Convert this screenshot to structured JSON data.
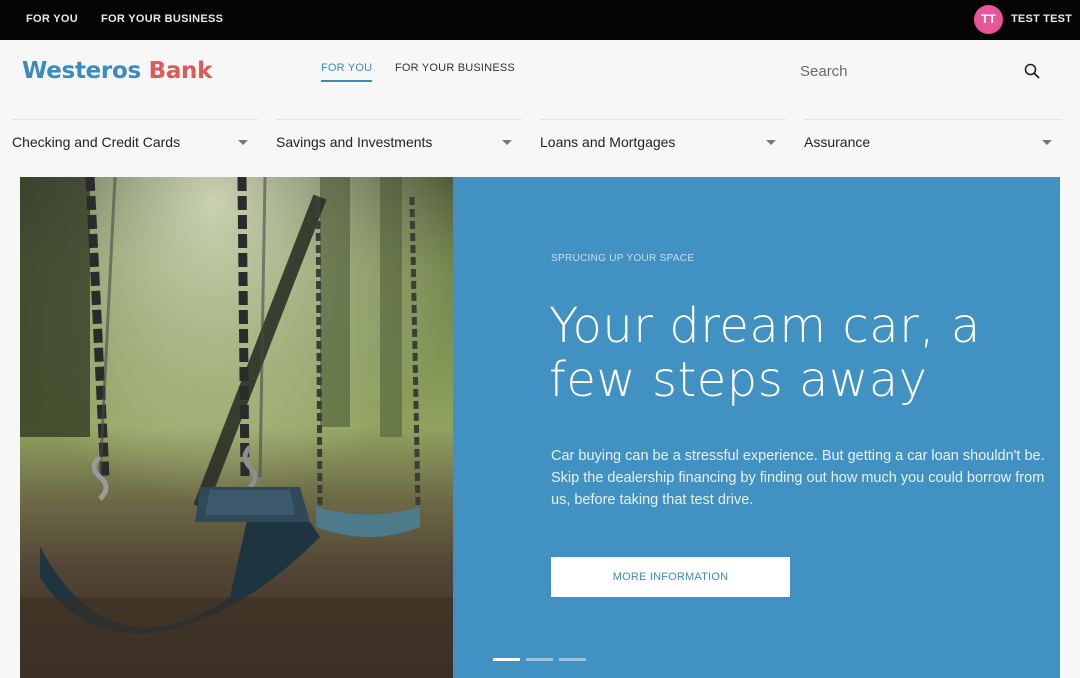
{
  "topbar": {
    "for_you": "FOR YOU",
    "for_your_business": "FOR YOUR BUSINESS",
    "avatar_initials": "TT",
    "user_name": "TEST TEST"
  },
  "header": {
    "logo_part1": "Westeros",
    "logo_part2": "Bank",
    "nav": [
      "FOR YOU",
      "FOR YOUR BUSINESS"
    ],
    "active_nav": "FOR YOU",
    "search_placeholder": "Search"
  },
  "categories": [
    "Checking and Credit Cards",
    "Savings and Investments",
    "Loans and Mortgages",
    "Assurance"
  ],
  "hero": {
    "eyebrow": "SPRUCING UP YOUR SPACE",
    "headline": "Your dream car, a few steps away",
    "body": "Car buying can be a stressful experience. But getting a car loan shouldn't be. Skip the dealership financing by finding out how much you could borrow from us, before taking that test drive.",
    "cta": "MORE INFORMATION",
    "slides_total": 3,
    "active_slide": 1
  },
  "colors": {
    "brand_blue": "#3a8bbf",
    "brand_red": "#e05858",
    "hero_panel": "#4191c2",
    "avatar": "#e9559a"
  },
  "icons": {
    "search": "search-icon",
    "dropdown": "caret-down-icon"
  }
}
